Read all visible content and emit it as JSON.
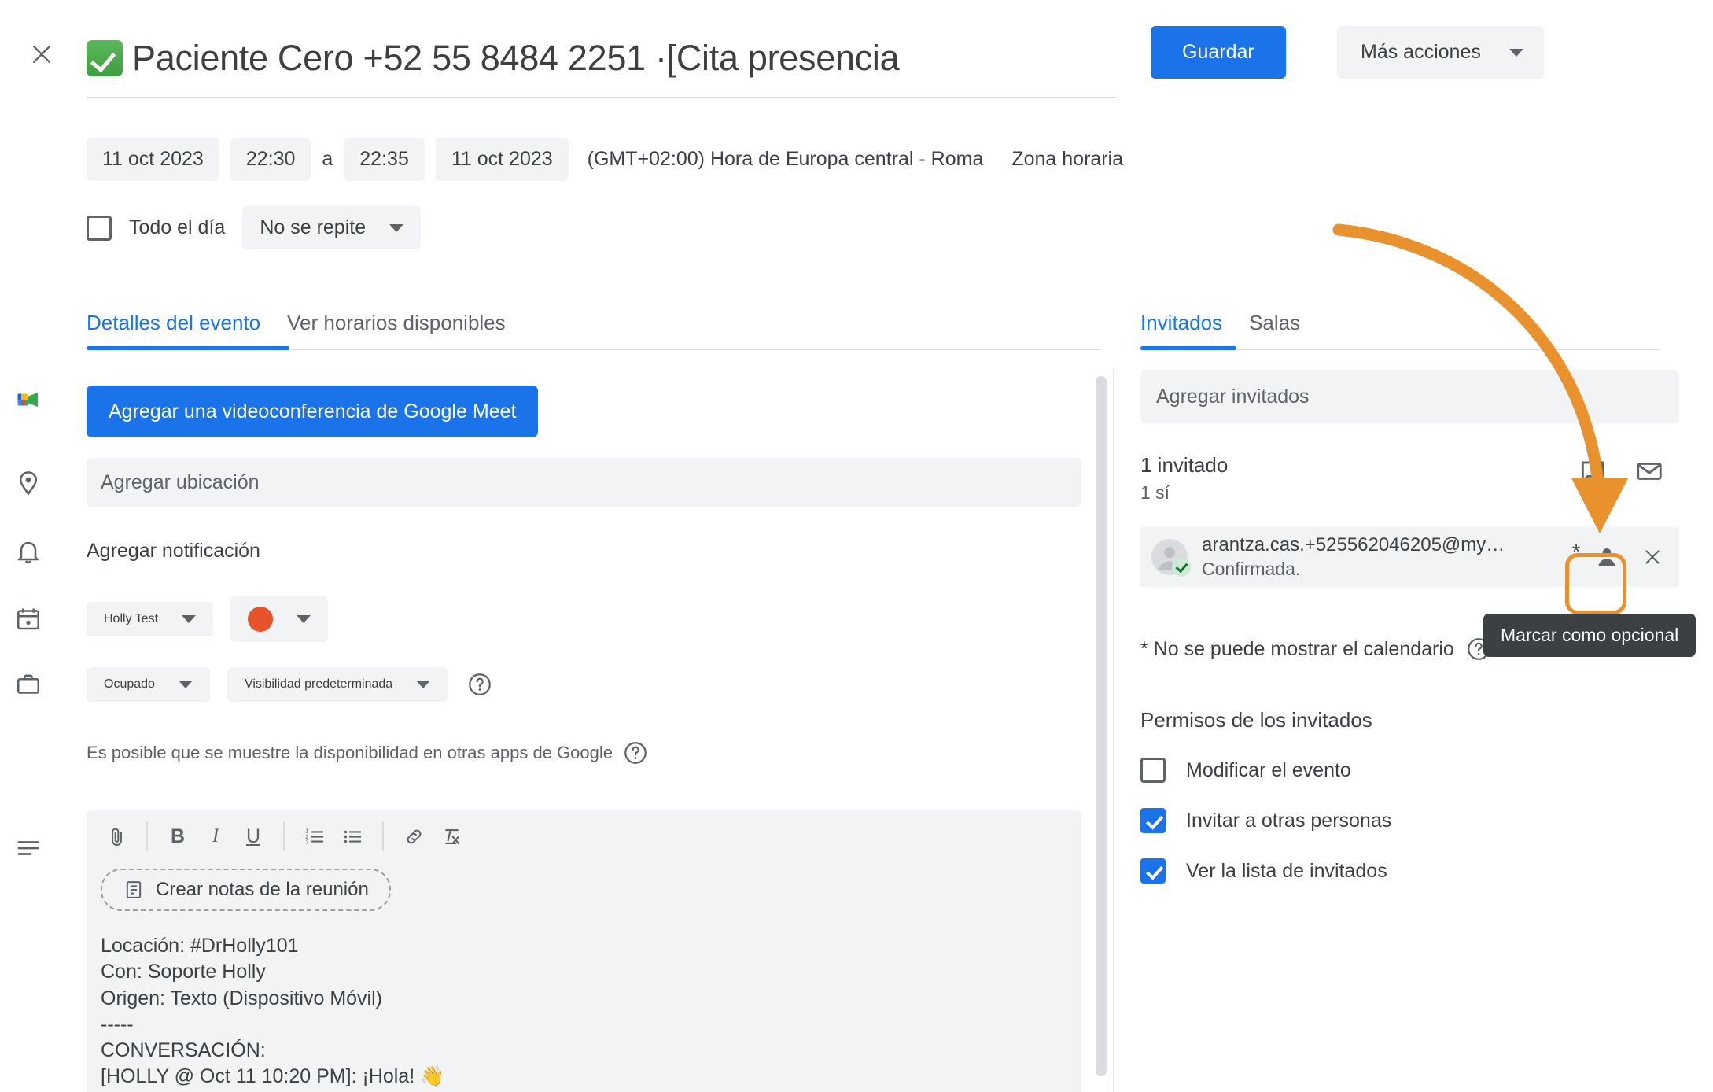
{
  "header": {
    "close_icon": "close-icon",
    "title_emoji": "white-check-mark-emoji",
    "title": "Paciente Cero +52 55 8484 2251 ·[Cita presencia",
    "save_label": "Guardar",
    "more_actions_label": "Más acciones"
  },
  "schedule": {
    "start_date": "11 oct 2023",
    "start_time": "22:30",
    "separator": "a",
    "end_time": "22:35",
    "end_date": "11 oct 2023",
    "timezone": "(GMT+02:00) Hora de Europa central - Roma",
    "timezone_link": "Zona horaria",
    "all_day_label": "Todo el día",
    "all_day_checked": false,
    "recurrence": "No se repite"
  },
  "left_tabs": [
    {
      "label": "Detalles del evento",
      "active": true
    },
    {
      "label": "Ver horarios disponibles",
      "active": false
    }
  ],
  "event_details": {
    "meet_button": "Agregar una videoconferencia de Google Meet",
    "location_placeholder": "Agregar ubicación",
    "notification_label": "Agregar notificación",
    "calendar_name": "Holly Test",
    "calendar_color": "#e8542a",
    "busy_status": "Ocupado",
    "visibility": "Visibilidad predeterminada",
    "availability_note": "Es posible que se muestre la disponibilidad en otras apps de Google"
  },
  "editor": {
    "toolbar": [
      "attach-icon",
      "bold-icon",
      "italic-icon",
      "underline-icon",
      "numbered-list-icon",
      "bulleted-list-icon",
      "link-icon",
      "clear-format-icon"
    ],
    "bold_label": "B",
    "italic_label": "I",
    "underline_label": "U",
    "meeting_notes_label": "Crear notas de la reunión",
    "description": "Locación: #DrHolly101\nCon: Soporte Holly\nOrigen: Texto (Dispositivo Móvil)\n-----\nCONVERSACIÓN:\n[HOLLY @ Oct 11 10:20 PM]: ¡Hola! 👋"
  },
  "right_tabs": [
    {
      "label": "Invitados",
      "active": true
    },
    {
      "label": "Salas",
      "active": false
    }
  ],
  "guests": {
    "input_placeholder": "Agregar invitados",
    "count_label": "1 invitado",
    "yes_label": "1 sí",
    "chat_icon": "chat-bubble-icon",
    "email_icon": "envelope-icon",
    "list": [
      {
        "email": "arantza.cas.+525562046205@my…",
        "status": "Confirmada.",
        "optional_marker": "*",
        "remove_icon": "close-icon"
      }
    ],
    "tooltip": "Marcar como opcional",
    "star_note": "* No se puede mostrar el calendario"
  },
  "permissions": {
    "title": "Permisos de los invitados",
    "items": [
      {
        "label": "Modificar el evento",
        "checked": false
      },
      {
        "label": "Invitar a otras personas",
        "checked": true
      },
      {
        "label": "Ver la lista de invitados",
        "checked": true
      }
    ]
  },
  "annotation": {
    "arrow_color": "#e8912d",
    "highlight_color": "#e8912d"
  }
}
